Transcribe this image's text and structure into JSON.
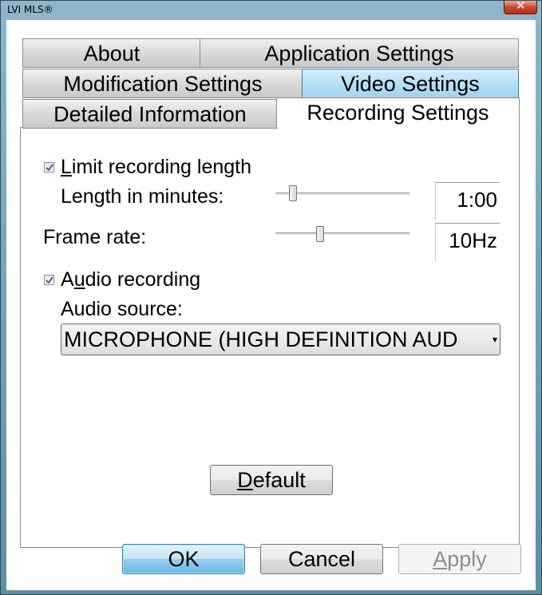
{
  "window": {
    "title": "LVI MLS®",
    "close_label": "✕"
  },
  "tabs": [
    {
      "label": "About"
    },
    {
      "label": "Application Settings"
    },
    {
      "label": "Modification Settings"
    },
    {
      "label": "Video Settings"
    },
    {
      "label": "Detailed Information"
    },
    {
      "label": "Recording Settings",
      "selected": true
    }
  ],
  "recording": {
    "limit_label_first": "L",
    "limit_label_rest": "imit recording length",
    "limit_checked": true,
    "length_label": "Length in minutes:",
    "length_value": "1:00",
    "length_slider_fraction": 0.11,
    "frame_rate_label": "Frame rate:",
    "frame_rate_value": "10Hz",
    "frame_rate_slider_fraction": 0.32,
    "audio_label_a": "A",
    "audio_label_u": "u",
    "audio_label_rest": "dio recording",
    "audio_checked": true,
    "audio_source_label": "Audio source:",
    "audio_source_value": "MICROPHONE (HIGH DEFINITION AUD",
    "default_first": "D",
    "default_rest": "efault"
  },
  "buttons": {
    "ok": "OK",
    "cancel": "Cancel",
    "apply_first": "A",
    "apply_rest": "pply"
  }
}
